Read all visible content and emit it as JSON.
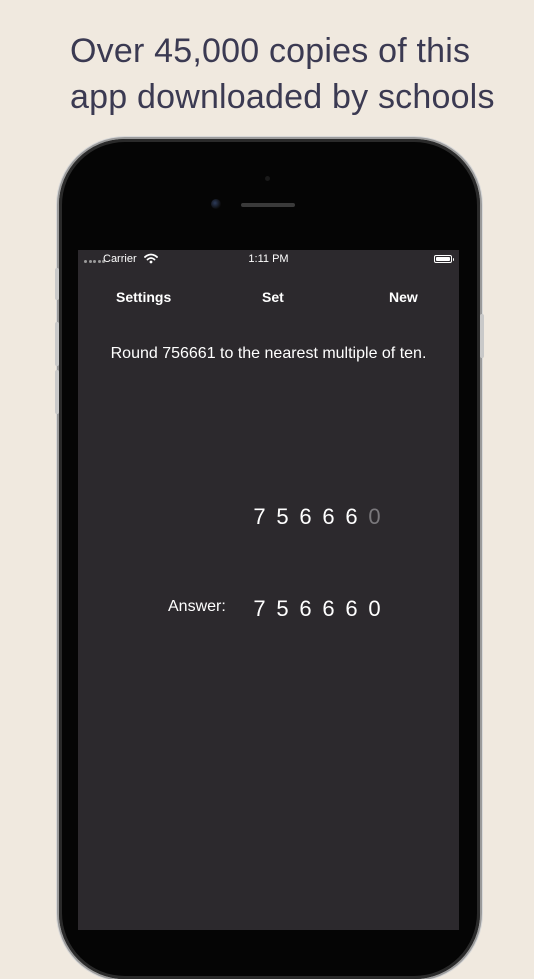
{
  "headline": "Over 45,000 copies of this app downloaded by schools",
  "status_bar": {
    "carrier": "Carrier",
    "time": "1:11 PM"
  },
  "nav": {
    "settings": "Settings",
    "set": "Set",
    "new": "New"
  },
  "question": "Round 756661 to the nearest multiple of ten.",
  "working_digits": [
    "7",
    "5",
    "6",
    "6",
    "6",
    "0"
  ],
  "answer": {
    "label": "Answer:",
    "digits": [
      "7",
      "5",
      "6",
      "6",
      "6",
      "0"
    ]
  },
  "colors": {
    "background": "#f0e9df",
    "screen": "#2c292d",
    "headline": "#3b3a52",
    "faded_digit": "#7a787c"
  }
}
